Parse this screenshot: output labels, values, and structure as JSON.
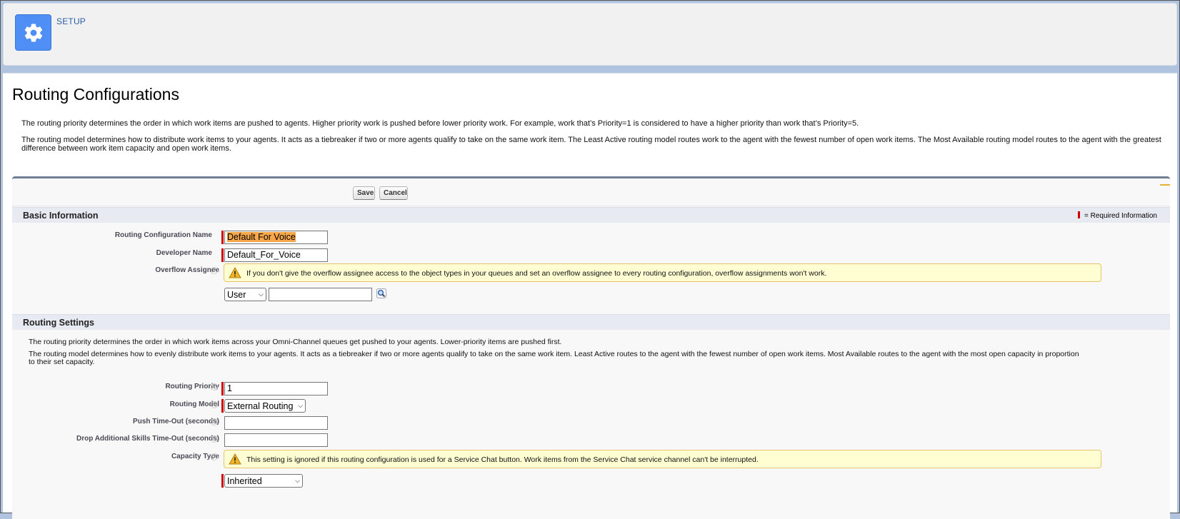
{
  "header": {
    "app_label": "SETUP",
    "icon": "gear-icon"
  },
  "page": {
    "title": "Routing Configurations",
    "intro_priority": "The routing priority determines the order in which work items are pushed to agents. Higher priority work is pushed before lower priority work. For example, work that’s Priority=1 is considered to have a higher priority than work that’s Priority=5.",
    "intro_model": "The routing model determines how to distribute work items to your agents. It acts as a tiebreaker if two or more agents qualify to take on the same work item. The Least Active routing model routes work to the agent with the fewest number of open work items. The Most Available routing model routes to the agent with the greatest difference between work item capacity and open work items."
  },
  "toolbar": {
    "save_label": "Save",
    "cancel_label": "Cancel"
  },
  "basic_info": {
    "title": "Basic Information",
    "required_note": "= Required Information",
    "routing_config_name_label": "Routing Configuration Name",
    "routing_config_name_value": "Default For Voice",
    "developer_name_label": "Developer Name",
    "developer_name_value": "Default_For_Voice",
    "overflow_assignee_label": "Overflow Assignee",
    "overflow_warning": "If you don't give the overflow assignee access to the object types in your queues and set an overflow assignee to every routing configuration, overflow assignments won't work.",
    "overflow_type_value": "User",
    "overflow_lookup_value": "",
    "lookup_icon": "search-icon"
  },
  "routing_settings": {
    "title": "Routing Settings",
    "desc_priority": "The routing priority determines the order in which work items across your Omni-Channel queues get pushed to your agents. Lower-priority items are pushed first.",
    "desc_model": "The routing model determines how to evenly distribute work items to your agents. It acts as a tiebreaker if two or more agents qualify to take on the same work item. Least Active routes to the agent with the fewest number of open work items. Most Available routes to the agent with the most open capacity in proportion to their set capacity.",
    "routing_priority_label": "Routing Priority",
    "routing_priority_value": "1",
    "routing_model_label": "Routing Model",
    "routing_model_value": "External Routing",
    "push_timeout_label": "Push Time-Out (seconds)",
    "push_timeout_value": "",
    "drop_skills_label": "Drop Additional Skills Time-Out (seconds)",
    "drop_skills_value": "",
    "capacity_type_label": "Capacity Type",
    "capacity_warning": "This setting is ignored if this routing configuration is used for a Service Chat button. Work items from the Service Chat service channel can't be interrupted.",
    "capacity_type_value": "Inherited"
  },
  "colors": {
    "accent": "#4f8ff5",
    "required": "#cc0000",
    "warning_bg": "#fffed3",
    "highlight": "#f8a64a"
  }
}
